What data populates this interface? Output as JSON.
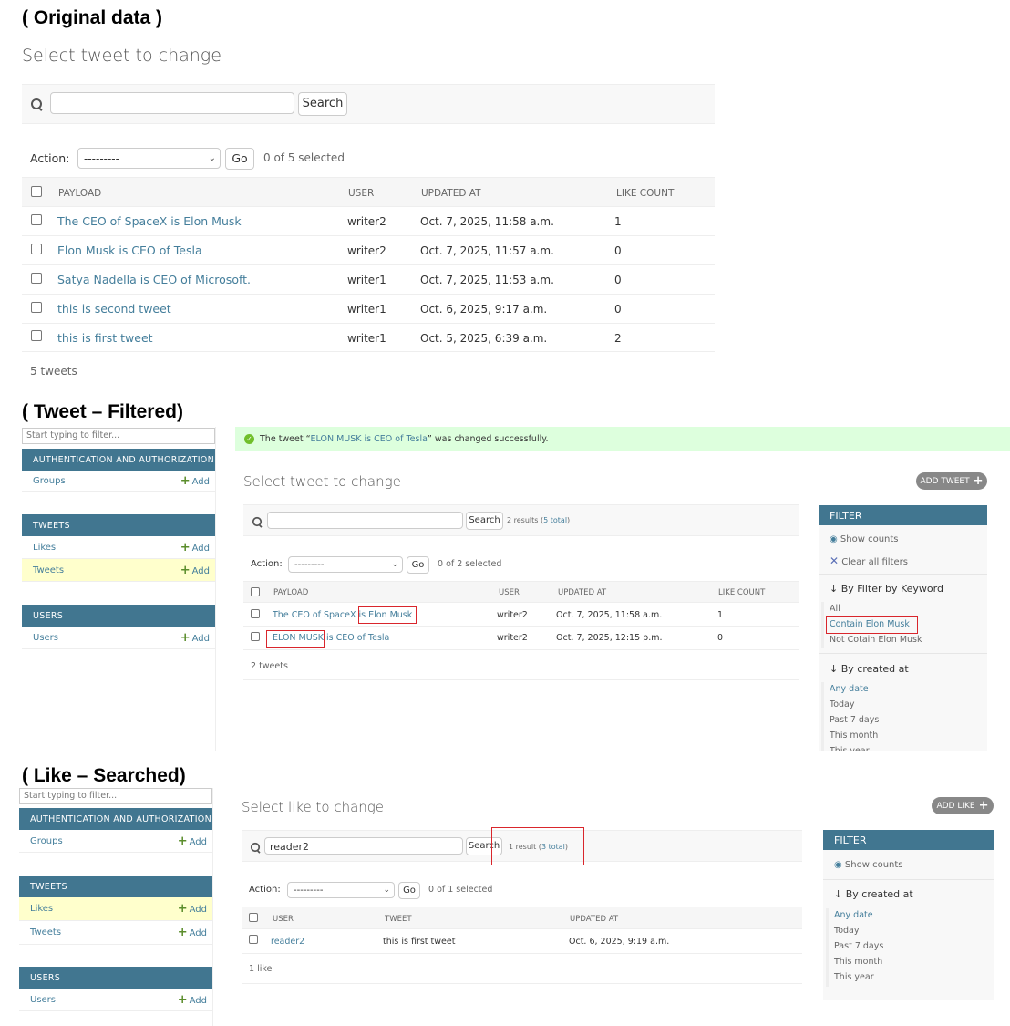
{
  "section1": {
    "caption": "( Original data )",
    "page_title": "Select tweet to change",
    "search_button": "Search",
    "action_label": "Action:",
    "action_value": "---------",
    "go_button": "Go",
    "selected_count": "0 of 5 selected",
    "columns": [
      "PAYLOAD",
      "USER",
      "UPDATED AT",
      "LIKE COUNT"
    ],
    "rows": [
      {
        "payload": "The CEO of SpaceX is Elon Musk",
        "user": "writer2",
        "updated": "Oct. 7, 2025, 11:58 a.m.",
        "likes": "1"
      },
      {
        "payload": "Elon Musk is CEO of Tesla",
        "user": "writer2",
        "updated": "Oct. 7, 2025, 11:57 a.m.",
        "likes": "0"
      },
      {
        "payload": "Satya Nadella is CEO of Microsoft.",
        "user": "writer1",
        "updated": "Oct. 7, 2025, 11:53 a.m.",
        "likes": "0"
      },
      {
        "payload": "this is second tweet",
        "user": "writer1",
        "updated": "Oct. 6, 2025, 9:17 a.m.",
        "likes": "0"
      },
      {
        "payload": "this is first tweet",
        "user": "writer1",
        "updated": "Oct. 5, 2025, 6:39 a.m.",
        "likes": "2"
      }
    ],
    "footer": "5 tweets"
  },
  "section2": {
    "caption": "( Tweet – Filtered)",
    "sidebar_filter_placeholder": "Start typing to filter...",
    "sidebar": {
      "auth_caption": "AUTHENTICATION AND AUTHORIZATION",
      "groups": "Groups",
      "tweets_caption": "TWEETS",
      "likes": "Likes",
      "tweets": "Tweets",
      "users_caption": "USERS",
      "users": "Users",
      "add": "Add"
    },
    "message_prefix": "The tweet “",
    "message_link": "ELON MUSK is CEO of Tesla",
    "message_suffix": "” was changed successfully.",
    "page_title": "Select tweet to change",
    "add_button": "ADD TWEET",
    "search_button": "Search",
    "results_prefix": "2 results (",
    "results_link": "5 total",
    "results_suffix": ")",
    "action_label": "Action:",
    "action_value": "---------",
    "go_button": "Go",
    "selected_count": "0 of 2 selected",
    "columns": [
      "PAYLOAD",
      "USER",
      "UPDATED AT",
      "LIKE COUNT"
    ],
    "rows": [
      {
        "payload": "The CEO of SpaceX is Elon Musk",
        "user": "writer2",
        "updated": "Oct. 7, 2025, 11:58 a.m.",
        "likes": "1"
      },
      {
        "payload": "ELON MUSK is CEO of Tesla",
        "user": "writer2",
        "updated": "Oct. 7, 2025, 12:15 p.m.",
        "likes": "0"
      }
    ],
    "footer": "2 tweets",
    "filter": {
      "caption": "FILTER",
      "show_counts": "Show counts",
      "clear_filters": "Clear all filters",
      "keyword_heading": "↓ By Filter by Keyword",
      "keyword_options": [
        "All",
        "Contain Elon Musk",
        "Not Cotain Elon Musk"
      ],
      "date_heading": "↓ By created at",
      "date_options": [
        "Any date",
        "Today",
        "Past 7 days",
        "This month",
        "This year"
      ]
    }
  },
  "section3": {
    "caption": "( Like – Searched)",
    "sidebar_filter_placeholder": "Start typing to filter...",
    "sidebar": {
      "auth_caption": "AUTHENTICATION AND AUTHORIZATION",
      "groups": "Groups",
      "tweets_caption": "TWEETS",
      "likes": "Likes",
      "tweets": "Tweets",
      "users_caption": "USERS",
      "users": "Users",
      "add": "Add"
    },
    "page_title": "Select like to change",
    "add_button": "ADD LIKE",
    "search_value": "reader2",
    "search_button": "Search",
    "results_prefix": "1 result (",
    "results_link": "3 total",
    "results_suffix": ")",
    "action_label": "Action:",
    "action_value": "---------",
    "go_button": "Go",
    "selected_count": "0 of 1 selected",
    "columns": [
      "USER",
      "TWEET",
      "UPDATED AT"
    ],
    "rows": [
      {
        "user": "reader2",
        "tweet": "this is first tweet",
        "updated": "Oct. 6, 2025, 9:19 a.m."
      }
    ],
    "footer": "1 like",
    "filter": {
      "caption": "FILTER",
      "show_counts": "Show counts",
      "date_heading": "↓ By created at",
      "date_options": [
        "Any date",
        "Today",
        "Past 7 days",
        "This month",
        "This year"
      ]
    }
  },
  "colors": {
    "header_blue": "#417690",
    "link": "#447e9b",
    "highlight_red": "#d9262c",
    "success_green": "#dfd",
    "current_row": "#ffffcc"
  },
  "icons": [
    "search-icon",
    "eye-icon",
    "clear-x-icon",
    "plus-icon",
    "check-circle-icon",
    "chevron-down-icon"
  ]
}
